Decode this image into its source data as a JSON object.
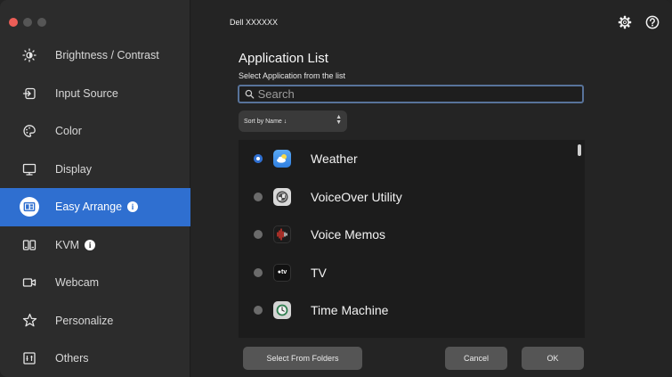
{
  "window": {
    "title": "Dell XXXXXX"
  },
  "sidebar": {
    "items": [
      {
        "label": "Brightness / Contrast",
        "icon": "brightness-icon"
      },
      {
        "label": "Input Source",
        "icon": "input-source-icon"
      },
      {
        "label": "Color",
        "icon": "color-palette-icon"
      },
      {
        "label": "Display",
        "icon": "display-icon"
      },
      {
        "label": "Easy Arrange",
        "icon": "easy-arrange-icon",
        "active": true,
        "info": true
      },
      {
        "label": "KVM",
        "icon": "kvm-icon",
        "info": true
      },
      {
        "label": "Webcam",
        "icon": "webcam-icon"
      },
      {
        "label": "Personalize",
        "icon": "star-icon"
      },
      {
        "label": "Others",
        "icon": "others-icon"
      }
    ]
  },
  "header": {
    "settings_icon": "gear-icon",
    "help_icon": "help-icon"
  },
  "main": {
    "title": "Application List",
    "subtitle": "Select Application from the list",
    "search": {
      "placeholder": "Search",
      "value": ""
    },
    "sort": {
      "label": "Sort by Name ↓"
    },
    "apps": [
      {
        "name": "Weather",
        "selected": true,
        "icon": "weather-app-icon"
      },
      {
        "name": "VoiceOver Utility",
        "selected": false,
        "icon": "voiceover-utility-icon"
      },
      {
        "name": "Voice Memos",
        "selected": false,
        "icon": "voice-memos-icon"
      },
      {
        "name": "TV",
        "selected": false,
        "icon": "apple-tv-icon"
      },
      {
        "name": "Time Machine",
        "selected": false,
        "icon": "time-machine-icon"
      }
    ]
  },
  "footer": {
    "select_from_folders": "Select From Folders",
    "cancel": "Cancel",
    "ok": "OK"
  },
  "colors": {
    "accent": "#2f6fd0",
    "sidebar_bg": "#2c2c2c",
    "main_bg": "#242424",
    "list_bg": "#1c1c1c"
  }
}
